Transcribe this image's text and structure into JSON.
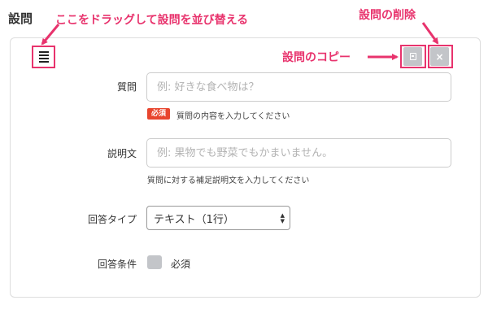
{
  "section_title": "設問",
  "annotations": {
    "drag": "ここをドラッグして設問を並び替える",
    "delete": "設問の削除",
    "copy": "設問のコピー"
  },
  "buttons": {
    "delete_symbol": "×"
  },
  "fields": {
    "question": {
      "label": "質問",
      "placeholder": "例: 好きな食べ物は？",
      "required_badge": "必須",
      "help": "質問の内容を入力してください"
    },
    "description": {
      "label": "説明文",
      "placeholder": "例: 果物でも野菜でもかまいません。",
      "help": "質問に対する補足説明文を入力してください"
    },
    "answer_type": {
      "label": "回答タイプ",
      "selected": "テキスト（1行）"
    },
    "answer_condition": {
      "label": "回答条件",
      "checkbox_label": "必須",
      "checked": false
    }
  },
  "colors": {
    "annotation": "#e8336d",
    "badge": "#e8452e",
    "icon_button": "#c3c5c9"
  },
  "icons": [
    "drag-handle-icon",
    "copy-icon",
    "delete-icon",
    "select-arrows-icon"
  ]
}
